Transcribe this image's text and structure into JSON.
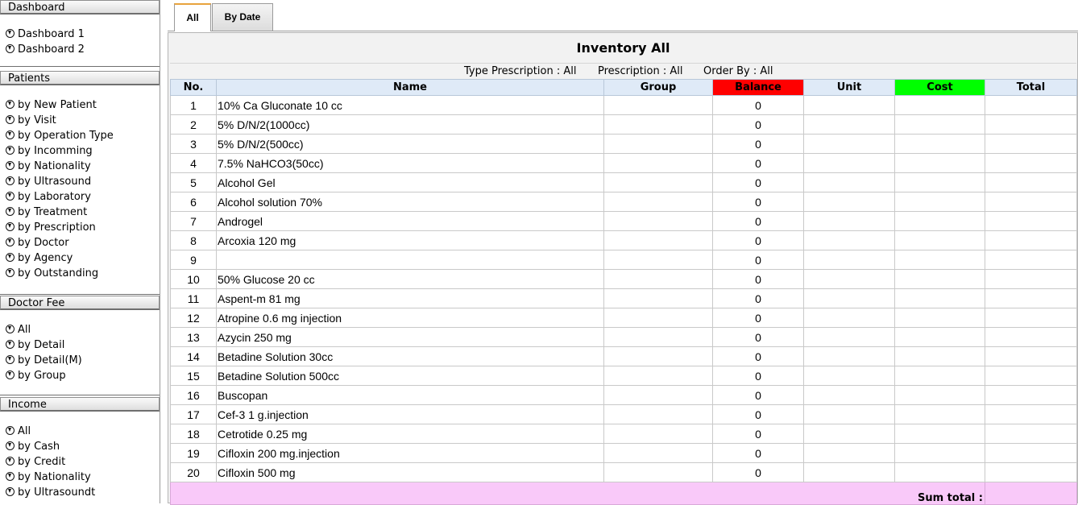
{
  "sidebar": {
    "sections": [
      {
        "title": "Dashboard",
        "items": [
          "Dashboard 1",
          "Dashboard 2"
        ]
      },
      {
        "title": "Patients",
        "items": [
          "by New Patient",
          "by Visit",
          "by Operation Type",
          "by Incomming",
          "by Nationality",
          "by Ultrasound",
          "by Laboratory",
          "by Treatment",
          "by Prescription",
          "by Doctor",
          "by Agency",
          "by Outstanding"
        ]
      },
      {
        "title": "Doctor Fee",
        "items": [
          "All",
          "by Detail",
          "by Detail(M)",
          "by Group"
        ]
      },
      {
        "title": "Income",
        "items": [
          "All",
          "by Cash",
          "by Credit",
          "by Nationality",
          "by Ultrasoundt"
        ]
      }
    ]
  },
  "tabs": {
    "all": "All",
    "by_date": "By Date"
  },
  "report": {
    "title": "Inventory All",
    "filters": {
      "type_prescription": "Type Prescription : All",
      "prescription": "Prescription : All",
      "order_by": "Order By : All"
    },
    "columns": {
      "no": "No.",
      "name": "Name",
      "group": "Group",
      "balance": "Balance",
      "unit": "Unit",
      "cost": "Cost",
      "total": "Total"
    },
    "colors": {
      "balance_header": "#ff0000",
      "cost_header": "#00ff00",
      "sum_row": "#f9c9f9"
    },
    "rows": [
      {
        "no": "1",
        "name": "10% Ca Gluconate 10 cc",
        "group": "",
        "balance": "0",
        "unit": "",
        "cost": "",
        "total": ""
      },
      {
        "no": "2",
        "name": "5% D/N/2(1000cc)",
        "group": "",
        "balance": "0",
        "unit": "",
        "cost": "",
        "total": ""
      },
      {
        "no": "3",
        "name": "5% D/N/2(500cc)",
        "group": "",
        "balance": "0",
        "unit": "",
        "cost": "",
        "total": ""
      },
      {
        "no": "4",
        "name": "7.5% NaHCO3(50cc)",
        "group": "",
        "balance": "0",
        "unit": "",
        "cost": "",
        "total": ""
      },
      {
        "no": "5",
        "name": "Alcohol Gel",
        "group": "",
        "balance": "0",
        "unit": "",
        "cost": "",
        "total": ""
      },
      {
        "no": "6",
        "name": "Alcohol solution 70%",
        "group": "",
        "balance": "0",
        "unit": "",
        "cost": "",
        "total": ""
      },
      {
        "no": "7",
        "name": "Androgel",
        "group": "",
        "balance": "0",
        "unit": "",
        "cost": "",
        "total": ""
      },
      {
        "no": "8",
        "name": "Arcoxia 120 mg",
        "group": "",
        "balance": "0",
        "unit": "",
        "cost": "",
        "total": ""
      },
      {
        "no": "9",
        "name": "",
        "group": "",
        "balance": "0",
        "unit": "",
        "cost": "",
        "total": ""
      },
      {
        "no": "10",
        "name": "50% Glucose 20 cc",
        "group": "",
        "balance": "0",
        "unit": "",
        "cost": "",
        "total": ""
      },
      {
        "no": "11",
        "name": "Aspent-m 81 mg",
        "group": "",
        "balance": "0",
        "unit": "",
        "cost": "",
        "total": ""
      },
      {
        "no": "12",
        "name": "Atropine 0.6 mg injection",
        "group": "",
        "balance": "0",
        "unit": "",
        "cost": "",
        "total": ""
      },
      {
        "no": "13",
        "name": "Azycin 250 mg",
        "group": "",
        "balance": "0",
        "unit": "",
        "cost": "",
        "total": ""
      },
      {
        "no": "14",
        "name": "Betadine Solution 30cc",
        "group": "",
        "balance": "0",
        "unit": "",
        "cost": "",
        "total": ""
      },
      {
        "no": "15",
        "name": "Betadine Solution 500cc",
        "group": "",
        "balance": "0",
        "unit": "",
        "cost": "",
        "total": ""
      },
      {
        "no": "16",
        "name": "Buscopan",
        "group": "",
        "balance": "0",
        "unit": "",
        "cost": "",
        "total": ""
      },
      {
        "no": "17",
        "name": "Cef-3 1 g.injection",
        "group": "",
        "balance": "0",
        "unit": "",
        "cost": "",
        "total": ""
      },
      {
        "no": "18",
        "name": "Cetrotide 0.25 mg",
        "group": "",
        "balance": "0",
        "unit": "",
        "cost": "",
        "total": ""
      },
      {
        "no": "19",
        "name": "Cifloxin 200 mg.injection",
        "group": "",
        "balance": "0",
        "unit": "",
        "cost": "",
        "total": ""
      },
      {
        "no": "20",
        "name": "Cifloxin 500 mg",
        "group": "",
        "balance": "0",
        "unit": "",
        "cost": "",
        "total": ""
      }
    ],
    "sum_label": "Sum total :",
    "sum_value": ""
  }
}
